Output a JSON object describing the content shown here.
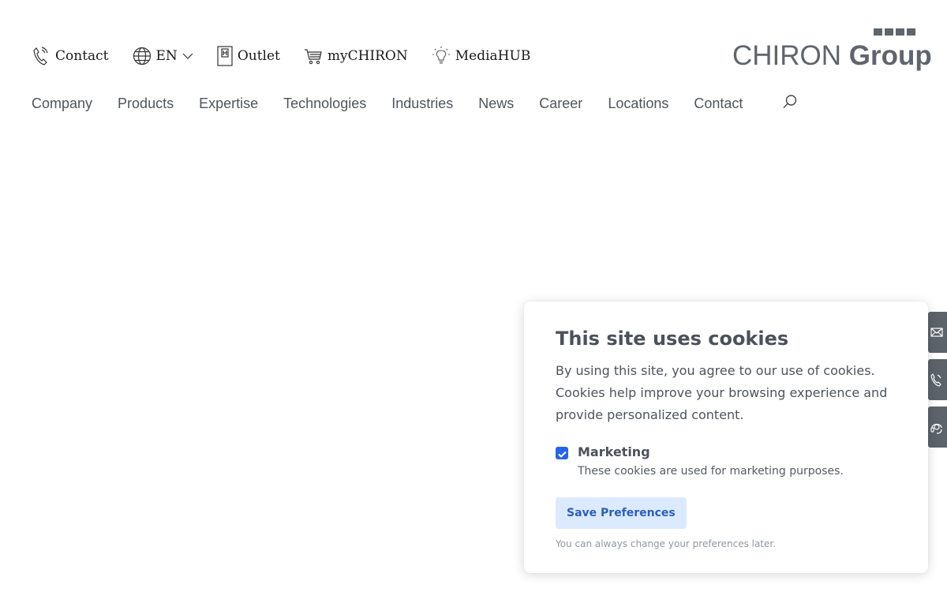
{
  "topbar": {
    "contact": "Contact",
    "language": "EN",
    "outlet": "Outlet",
    "mychiron": "myCHIRON",
    "mediahub": "MediaHUB"
  },
  "logo": {
    "word1": "CHIRON ",
    "word2": "Group"
  },
  "nav": {
    "items": [
      "Company",
      "Products",
      "Expertise",
      "Technologies",
      "Industries",
      "News",
      "Career",
      "Locations",
      "Contact"
    ]
  },
  "cookie": {
    "title": "This site uses cookies",
    "text": "By using this site, you agree to our use of cookies. Cookies help improve your browsing experience and provide personalized content.",
    "option_title": "Marketing",
    "option_desc": "These cookies are used for marketing purposes.",
    "option_checked": true,
    "save_label": "Save Preferences",
    "note": "You can always change your preferences later."
  },
  "colors": {
    "accent": "#2563eb",
    "button_bg": "#dbeafe",
    "logo": "#5f656c",
    "side_tab": "#5c636a"
  },
  "icons": [
    "phone-icon",
    "globe-icon",
    "chevron-down-icon",
    "outlet-icon",
    "cart-icon",
    "lightbulb-icon",
    "search-icon",
    "mail-icon",
    "phone-icon",
    "headset-icon",
    "check-icon"
  ]
}
